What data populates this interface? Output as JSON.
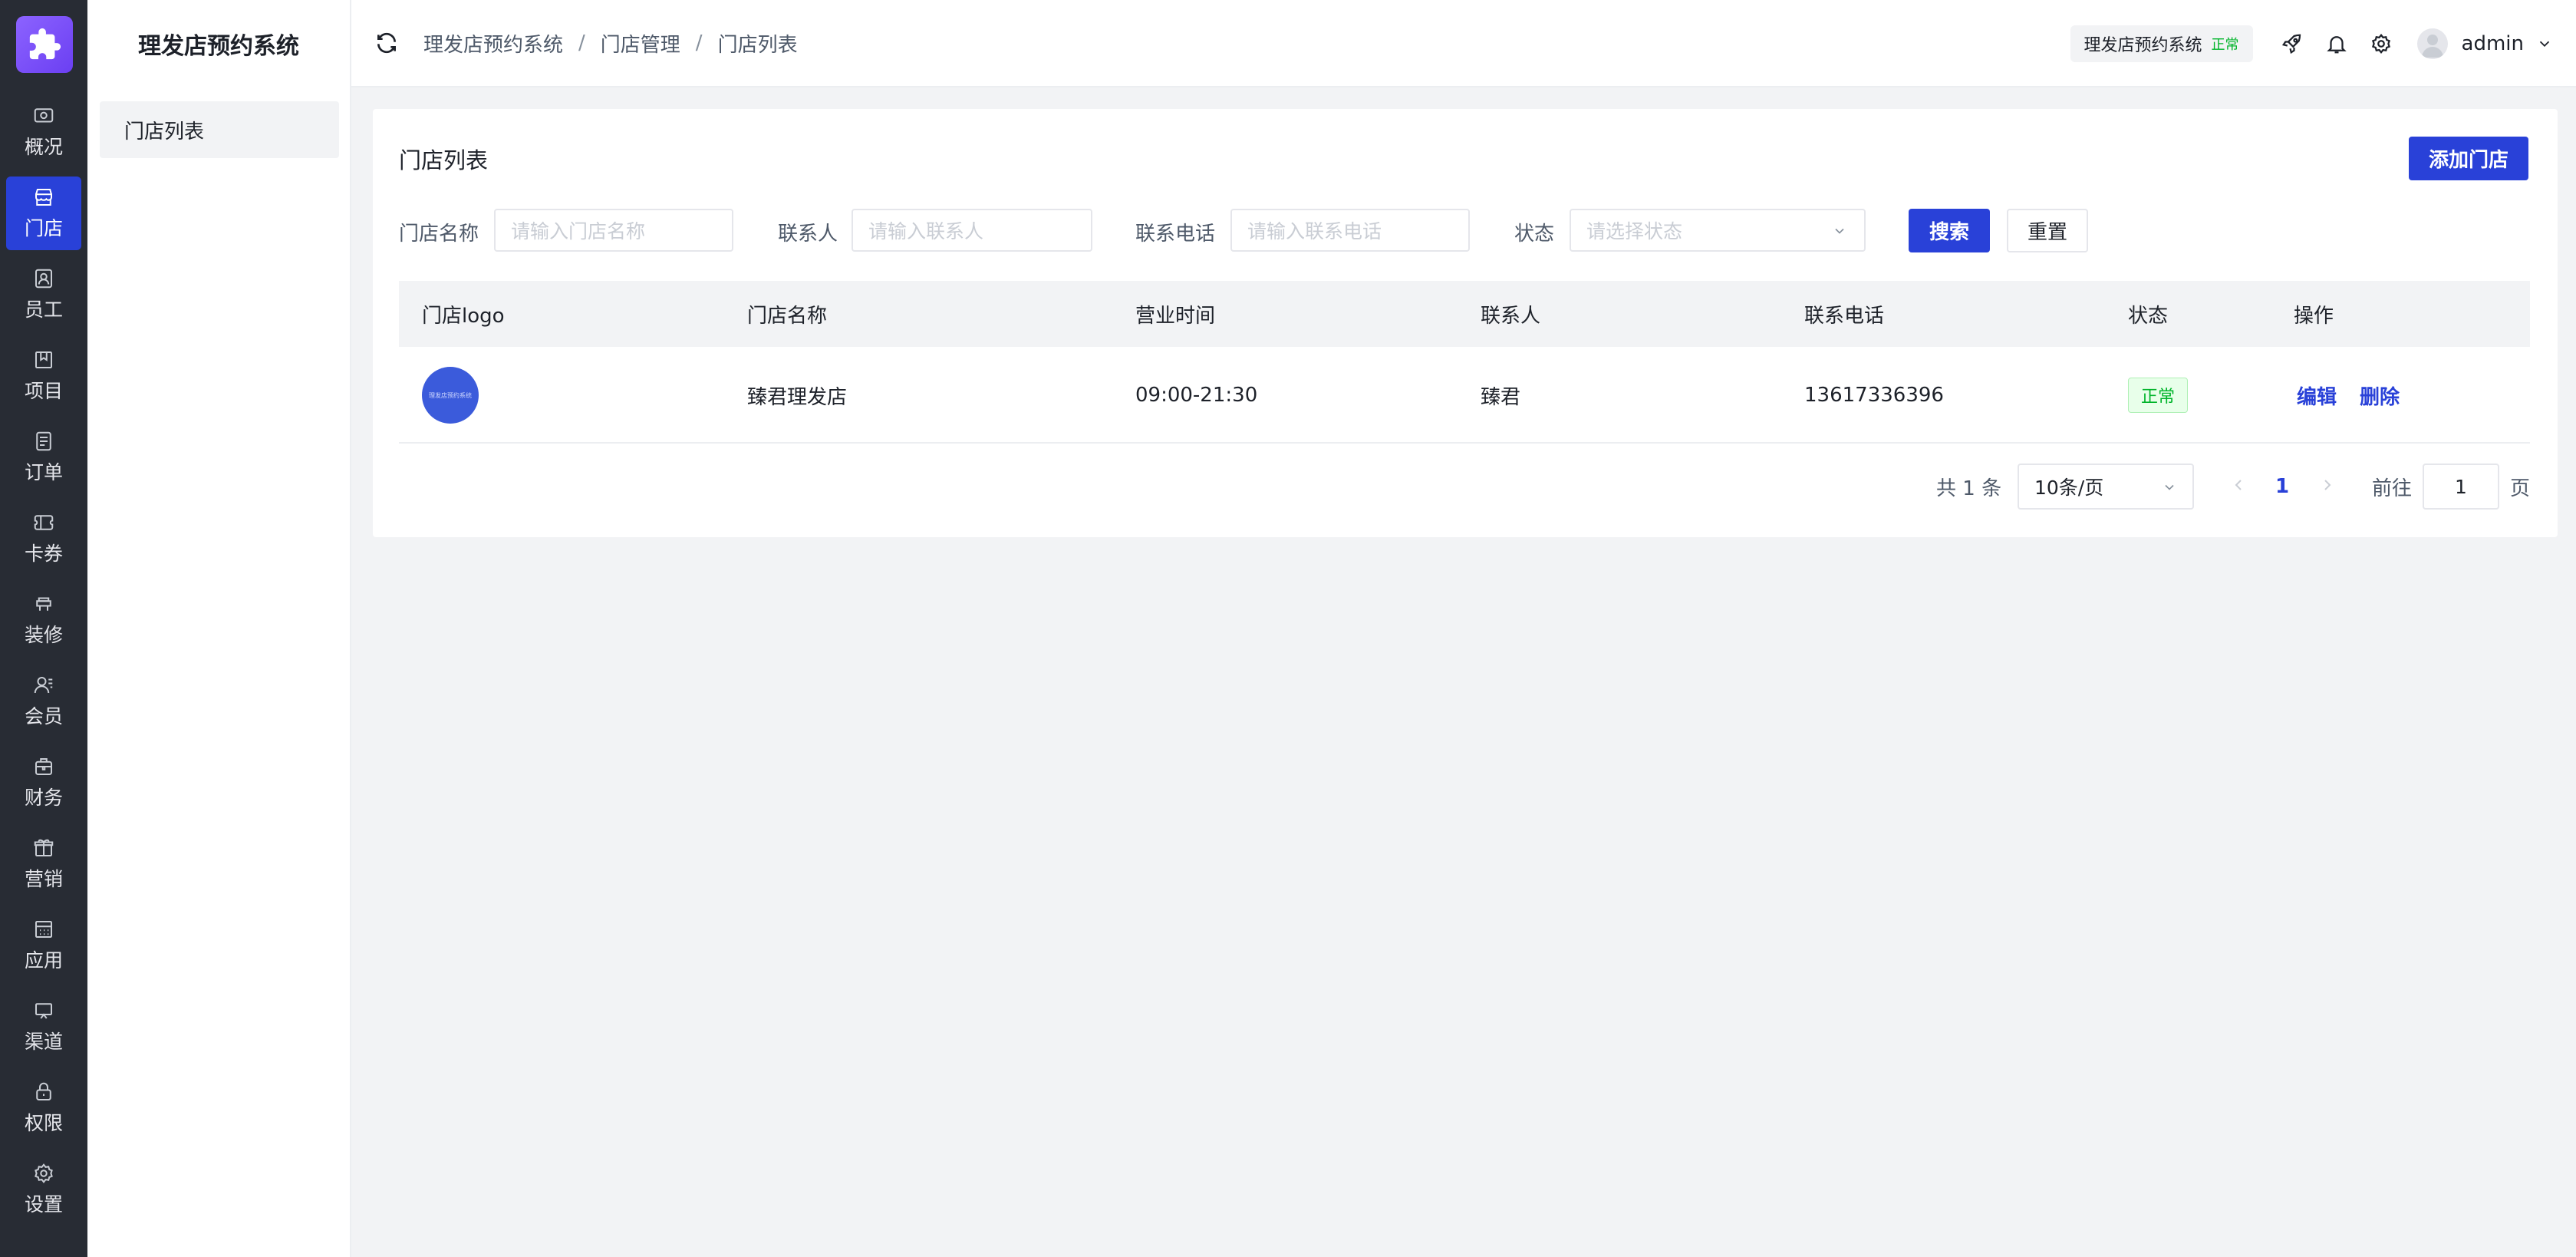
{
  "app": {
    "name": "理发店预约系统",
    "rail_items": [
      {
        "label": "概况",
        "icon": "dashboard-icon"
      },
      {
        "label": "门店",
        "icon": "store-icon",
        "active": true
      },
      {
        "label": "员工",
        "icon": "staff-icon"
      },
      {
        "label": "项目",
        "icon": "project-icon"
      },
      {
        "label": "订单",
        "icon": "order-icon"
      },
      {
        "label": "卡券",
        "icon": "coupon-icon"
      },
      {
        "label": "装修",
        "icon": "decorate-icon"
      },
      {
        "label": "会员",
        "icon": "member-icon"
      },
      {
        "label": "财务",
        "icon": "finance-icon"
      },
      {
        "label": "营销",
        "icon": "marketing-icon"
      },
      {
        "label": "应用",
        "icon": "apps-icon"
      },
      {
        "label": "渠道",
        "icon": "channel-icon"
      },
      {
        "label": "权限",
        "icon": "lock-icon"
      },
      {
        "label": "设置",
        "icon": "settings-icon"
      }
    ]
  },
  "subside": {
    "title": "理发店预约系统",
    "menu": [
      {
        "label": "门店列表"
      }
    ]
  },
  "header": {
    "breadcrumb": [
      "理发店预约系统",
      "门店管理",
      "门店列表"
    ],
    "separator": "/",
    "system_badge": {
      "name": "理发店预约系统",
      "status": "正常"
    },
    "username": "admin"
  },
  "page": {
    "title": "门店列表",
    "add_button": "添加门店"
  },
  "filters": {
    "store_name": {
      "label": "门店名称",
      "placeholder": "请输入门店名称"
    },
    "contact": {
      "label": "联系人",
      "placeholder": "请输入联系人"
    },
    "phone": {
      "label": "联系电话",
      "placeholder": "请输入联系电话"
    },
    "status": {
      "label": "状态",
      "placeholder": "请选择状态"
    },
    "search_button": "搜索",
    "reset_button": "重置"
  },
  "table": {
    "columns": [
      "门店logo",
      "门店名称",
      "营业时间",
      "联系人",
      "联系电话",
      "状态",
      "操作"
    ],
    "rows": [
      {
        "logo_text": "理发店预约系统",
        "name": "臻君理发店",
        "hours": "09:00-21:30",
        "contact": "臻君",
        "phone": "13617336396",
        "status": "正常",
        "actions": [
          "编辑",
          "删除"
        ]
      }
    ]
  },
  "pagination": {
    "total_text": "共 1 条",
    "page_size": "10条/页",
    "current_page": "1",
    "goto_label": "前往",
    "goto_value": "1",
    "page_suffix": "页"
  },
  "colors": {
    "primary": "#2941d8",
    "rail_bg": "#282c34",
    "success": "#00b42a"
  }
}
